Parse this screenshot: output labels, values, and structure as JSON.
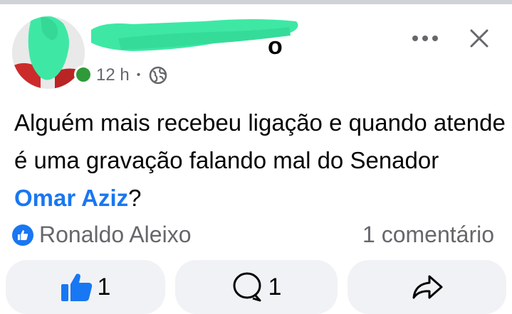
{
  "post": {
    "time": "12 h",
    "separator": "•",
    "privacy_icon": "globe-icon",
    "text_before_mention": "Alguém mais recebeu ligação e quando atende é uma gravação falando mal do Senador ",
    "mention": "Omar Aziz",
    "text_after_mention": "?",
    "online": true
  },
  "engagement": {
    "reactor_name": "Ronaldo Aleixo",
    "comments_label": "1 comentário"
  },
  "actions": {
    "like_count": "1",
    "comment_count": "1"
  },
  "colors": {
    "accent": "#1877f2",
    "secondary_text": "#65676b",
    "button_bg": "#f0f2f5",
    "online": "#2f9a3a",
    "redaction": "#3ee8a4"
  }
}
